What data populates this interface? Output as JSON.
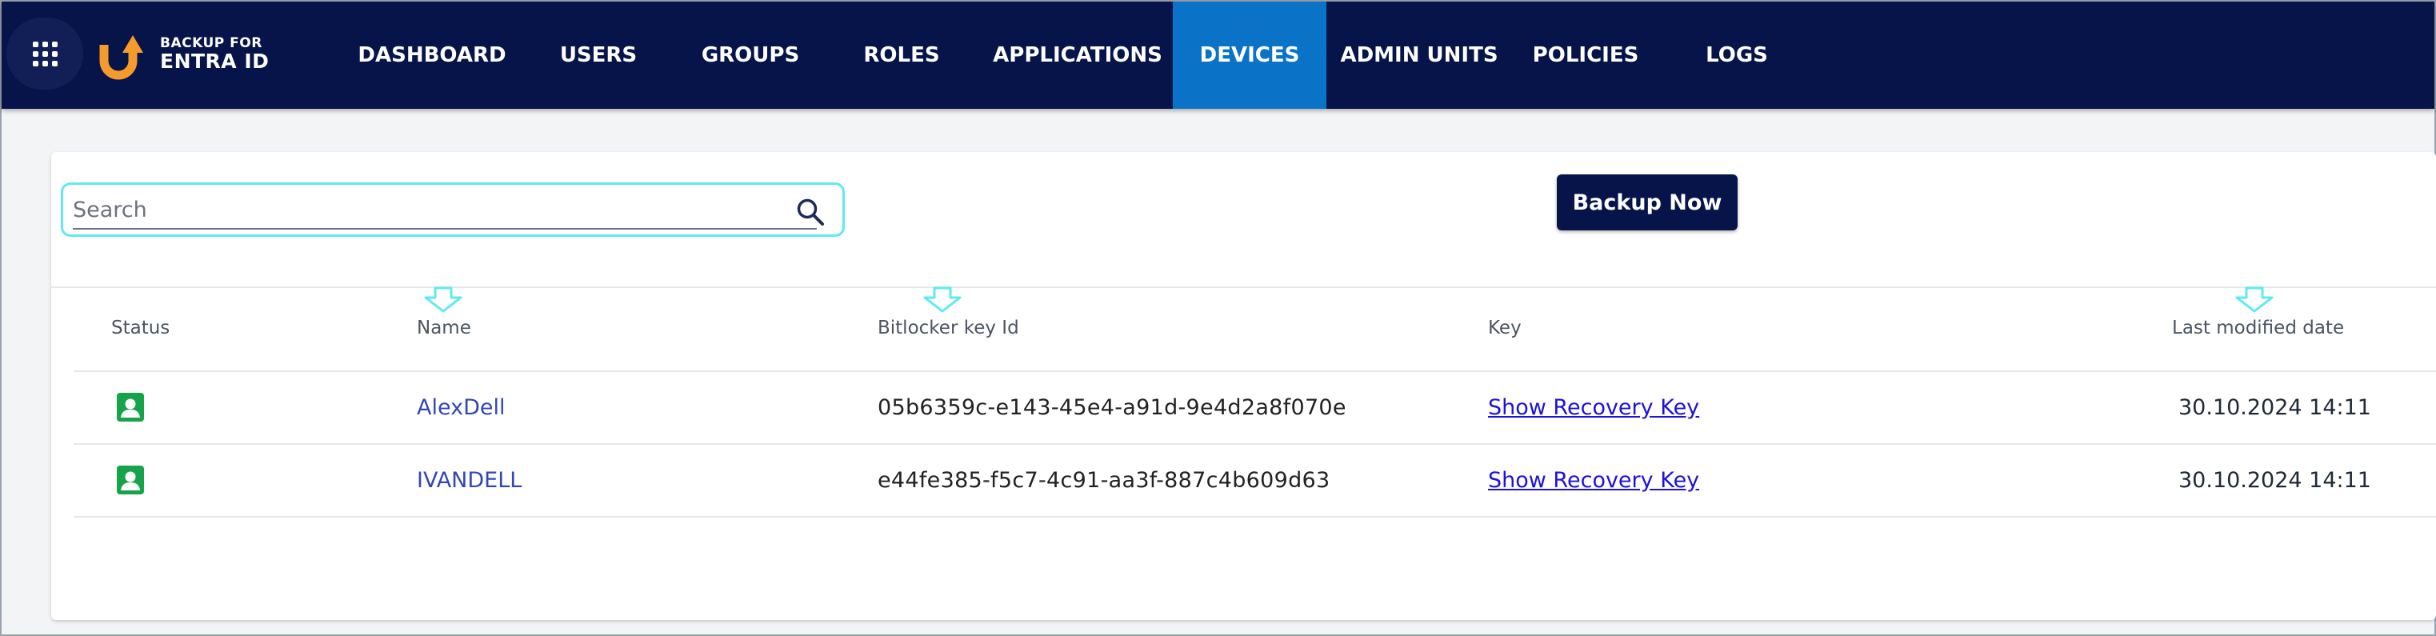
{
  "app": {
    "logo_line1": "BACKUP FOR",
    "logo_line2": "ENTRA ID",
    "brand_color": "#06144a",
    "accent_color": "#0b73c7",
    "logo_color": "#f59a2c"
  },
  "nav": {
    "apps_icon": "apps-grid-icon",
    "items": [
      {
        "label": "DASHBOARD",
        "active": false
      },
      {
        "label": "USERS",
        "active": false
      },
      {
        "label": "GROUPS",
        "active": false
      },
      {
        "label": "ROLES",
        "active": false
      },
      {
        "label": "APPLICATIONS",
        "active": false
      },
      {
        "label": "DEVICES",
        "active": true
      },
      {
        "label": "ADMIN UNITS",
        "active": false
      },
      {
        "label": "POLICIES",
        "active": false
      },
      {
        "label": "LOGS",
        "active": false
      }
    ]
  },
  "toolbar": {
    "search_placeholder": "Search",
    "search_value": "",
    "search_icon": "search-icon",
    "backup_label": "Backup Now"
  },
  "table": {
    "columns": [
      "Status",
      "Name",
      "Bitlocker key Id",
      "Key",
      "Last modified date"
    ],
    "sortable_columns": [
      "Name",
      "Bitlocker key Id",
      "Last modified date"
    ],
    "rows": [
      {
        "status_icon": "user-badge-icon",
        "status_color": "#16a34a",
        "name": "AlexDell",
        "key_id": "05b6359c-e143-45e4-a91d-9e4d2a8f070e",
        "key_link": "Show Recovery Key",
        "modified": "30.10.2024 14:11"
      },
      {
        "status_icon": "user-badge-icon",
        "status_color": "#16a34a",
        "name": "IVANDELL",
        "key_id": "e44fe385-f5c7-4c91-aa3f-887c4b609d63",
        "key_link": "Show Recovery Key",
        "modified": "30.10.2024 14:11"
      }
    ]
  }
}
